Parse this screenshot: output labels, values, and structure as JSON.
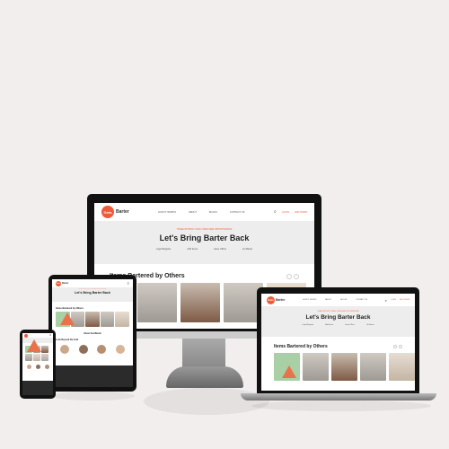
{
  "site": {
    "logo_mark": "Gets",
    "logo_text": "Barter",
    "nav": [
      "HOW IT WORKS",
      "ABOUT",
      "BLOGS",
      "CONTACT US"
    ],
    "nav_login": "LOGIN",
    "nav_cta": "ADD ITEMS"
  },
  "hero": {
    "eyebrow": "TRADE WITHOUT CASH, OPEN NEW OPPORTUNITIES",
    "title": "Let's Bring Barter Back",
    "steps": [
      "Login/Register",
      "Add Items",
      "Have Offers",
      "Go Barter"
    ]
  },
  "items": {
    "title": "Items Bartered by Others"
  },
  "tablet_extra": {
    "section_title": "Items Bartered by Others",
    "about_title": "About GetsBarter",
    "stories_title": "Look Beyond the Fold"
  },
  "colors": {
    "accent": "#ef5b3a",
    "hero_bg": "#ededed",
    "page_bg": "#f3eeee"
  }
}
